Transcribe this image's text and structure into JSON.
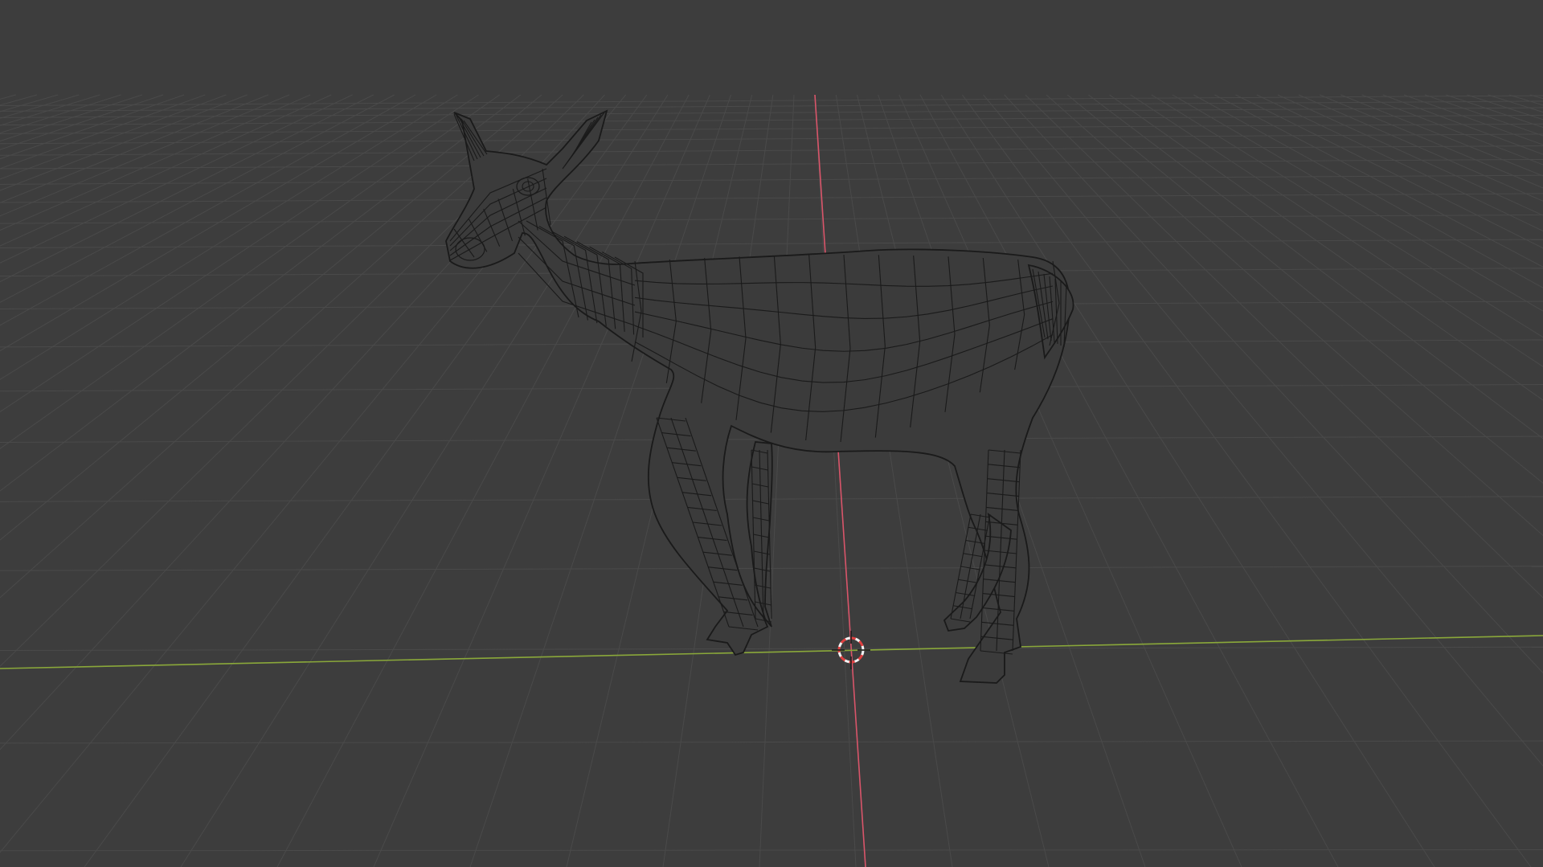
{
  "viewport": {
    "background_color": "#3d3d3d",
    "grid_color": "#4a4a4a",
    "x_axis_color": "#8aa83a",
    "y_axis_color": "#d9556a",
    "mesh_wire_color": "#1a1a1a",
    "mesh_fill_color": "#3b3b3b",
    "cursor_colors": [
      "#e04040",
      "#f2f2f2"
    ]
  },
  "scene": {
    "object": "deer-wireframe-mesh",
    "view_mode": "wireframe",
    "cursor_icon": "3d-cursor-icon"
  }
}
